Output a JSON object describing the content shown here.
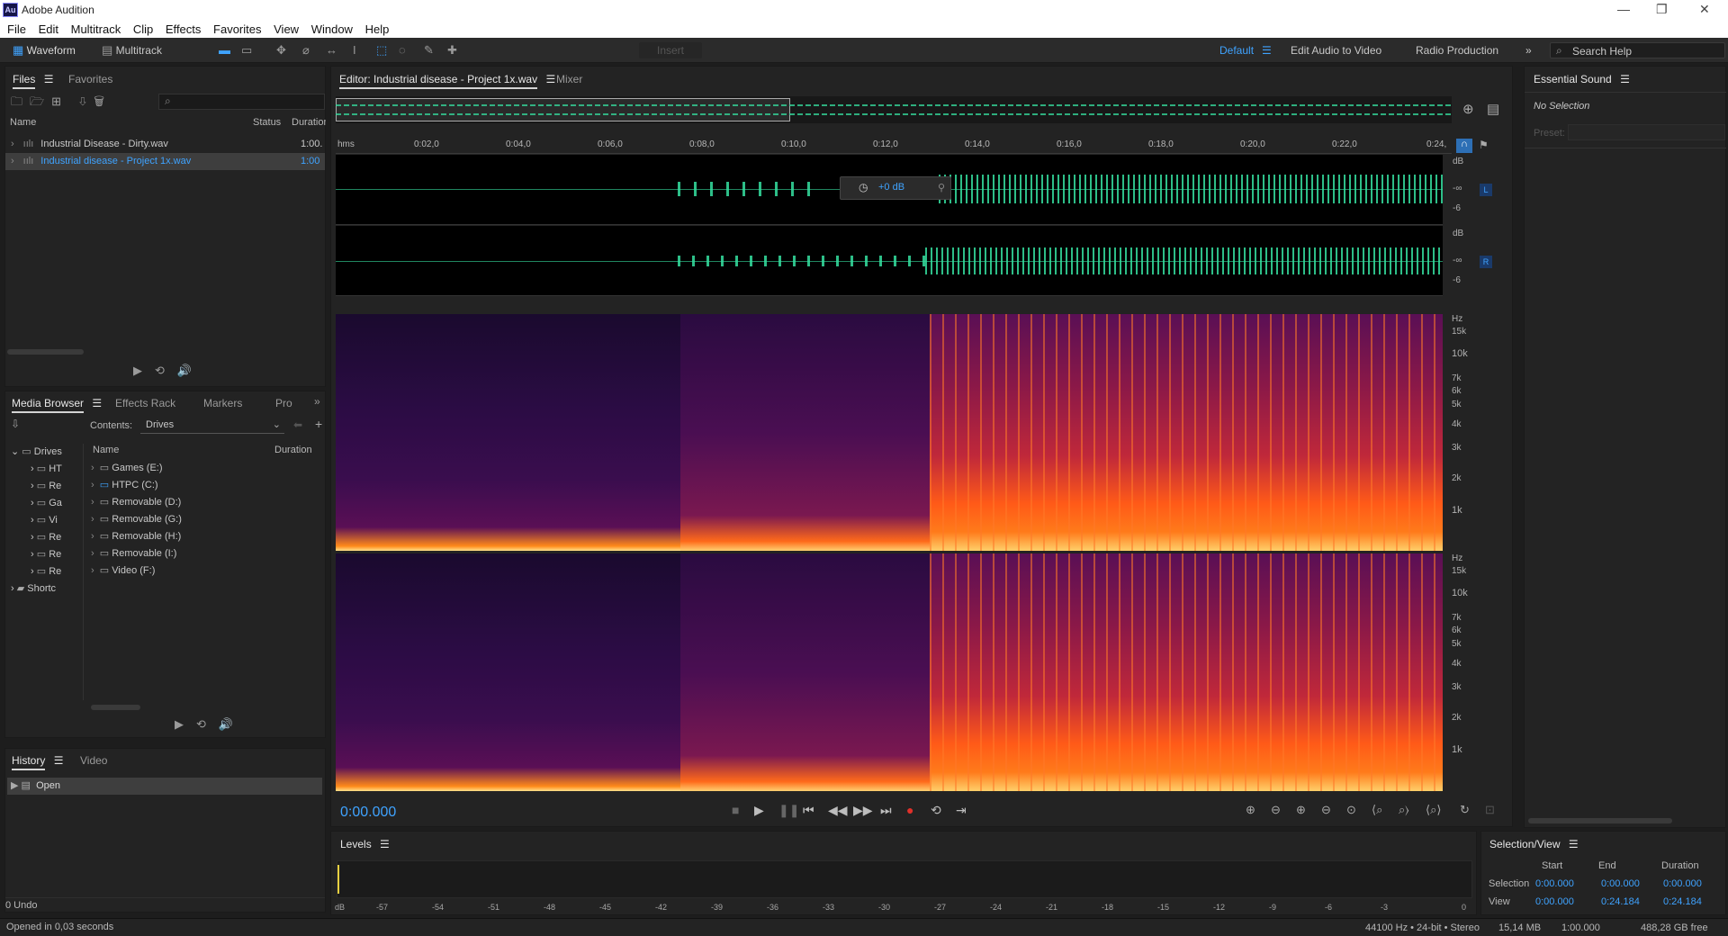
{
  "app": {
    "title": "Adobe Audition",
    "logo": "Au"
  },
  "menu": [
    "File",
    "Edit",
    "Multitrack",
    "Clip",
    "Effects",
    "Favorites",
    "View",
    "Window",
    "Help"
  ],
  "toolbar": {
    "waveform": "Waveform",
    "multitrack": "Multitrack",
    "insert": "Insert",
    "workspaces": [
      "Default",
      "Edit Audio to Video",
      "Radio Production"
    ],
    "search_placeholder": "Search Help"
  },
  "files": {
    "tabs": [
      "Files",
      "Favorites"
    ],
    "columns": [
      "Name",
      "Status",
      "Duration"
    ],
    "items": [
      {
        "name": "Industrial Disease - Dirty.wav",
        "duration": "1:00."
      },
      {
        "name": "Industrial disease - Project 1x.wav",
        "duration": "1:00"
      }
    ]
  },
  "media": {
    "tabs": [
      "Media Browser",
      "Effects Rack",
      "Markers",
      "Pro"
    ],
    "contents_label": "Contents:",
    "contents_value": "Drives",
    "tree": [
      "Drives",
      "HT",
      "Re",
      "Ga",
      "Vi",
      "Re",
      "Re",
      "Re",
      "Shortc"
    ],
    "columns": [
      "Name",
      "Duration"
    ],
    "drives": [
      "Games (E:)",
      "HTPC (C:)",
      "Removable (D:)",
      "Removable (G:)",
      "Removable (H:)",
      "Removable (I:)",
      "Video (F:)"
    ]
  },
  "history": {
    "tabs": [
      "History",
      "Video"
    ],
    "items": [
      "Open"
    ],
    "undo": "0 Undo"
  },
  "editor": {
    "tab": "Editor: Industrial disease - Project 1x.wav",
    "mixer": "Mixer",
    "ruler": [
      "hms",
      "0:02,0",
      "0:04,0",
      "0:06,0",
      "0:08,0",
      "0:10,0",
      "0:12,0",
      "0:14,0",
      "0:16,0",
      "0:18,0",
      "0:20,0",
      "0:22,0",
      "0:24,"
    ],
    "gain": "+0 dB",
    "db_labels": [
      "dB",
      "-∞",
      "-6"
    ],
    "ch_left": "L",
    "ch_right": "R",
    "hz_labels": [
      "Hz",
      "15k",
      "10k",
      "7k",
      "6k",
      "5k",
      "4k",
      "3k",
      "2k",
      "1k"
    ],
    "time": "0:00.000"
  },
  "essential": {
    "title": "Essential Sound",
    "no_selection": "No Selection",
    "preset": "Preset:"
  },
  "levels": {
    "title": "Levels",
    "scale": [
      "dB",
      "-57",
      "-54",
      "-51",
      "-48",
      "-45",
      "-42",
      "-39",
      "-36",
      "-33",
      "-30",
      "-27",
      "-24",
      "-21",
      "-18",
      "-15",
      "-12",
      "-9",
      "-6",
      "-3",
      "0"
    ]
  },
  "selection": {
    "title": "Selection/View",
    "cols": [
      "Start",
      "End",
      "Duration"
    ],
    "rows": [
      {
        "label": "Selection",
        "start": "0:00.000",
        "end": "0:00.000",
        "duration": "0:00.000"
      },
      {
        "label": "View",
        "start": "0:00.000",
        "end": "0:24.184",
        "duration": "0:24.184"
      }
    ]
  },
  "status": {
    "left": "Opened in 0,03 seconds",
    "format": "44100 Hz • 24-bit • Stereo",
    "size": "15,14 MB",
    "duration": "1:00.000",
    "free": "488,28 GB free"
  },
  "colors": {
    "accent": "#3fa3ff",
    "waveform": "#35e0a0",
    "record": "#e0302a"
  }
}
